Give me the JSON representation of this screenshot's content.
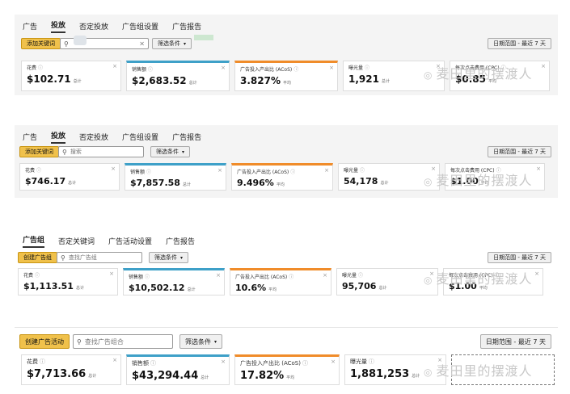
{
  "panel1": {
    "tabs": [
      "广告",
      "投放",
      "否定投放",
      "广告组设置",
      "广告报告"
    ],
    "active_tab": 1,
    "primary_button": "添加关键词",
    "search_placeholder": "",
    "filter_button": "筛选条件",
    "date_button": "日期范围 - 最近 7 天",
    "cards": [
      {
        "label": "花费",
        "value": "$102.71",
        "unit": "总计"
      },
      {
        "label": "销售额",
        "value": "$2,683.52",
        "unit": "总计"
      },
      {
        "label": "广告投入产出比 (ACoS)",
        "value": "3.827%",
        "unit": "平均"
      },
      {
        "label": "曝光量",
        "value": "1,921",
        "unit": "总计"
      },
      {
        "label": "每次点击费用 (CPC)",
        "value": "$0.85",
        "unit": "平均"
      }
    ]
  },
  "panel2": {
    "tabs": [
      "广告",
      "投放",
      "否定投放",
      "广告组设置",
      "广告报告"
    ],
    "active_tab": 1,
    "primary_button": "添加关键词",
    "search_placeholder": "搜索",
    "filter_button": "筛选条件",
    "date_button": "日期范围 - 最近 7 天",
    "cards": [
      {
        "label": "花费",
        "value": "$746.17",
        "unit": "总计"
      },
      {
        "label": "销售额",
        "value": "$7,857.58",
        "unit": "总计"
      },
      {
        "label": "广告投入产出比 (ACoS)",
        "value": "9.496%",
        "unit": "平均"
      },
      {
        "label": "曝光量",
        "value": "54,178",
        "unit": "总计"
      },
      {
        "label": "每次点击费用 (CPC)",
        "value": "$1.00",
        "unit": "平均"
      }
    ]
  },
  "panel3": {
    "tabs": [
      "广告组",
      "否定关键词",
      "广告活动设置",
      "广告报告"
    ],
    "active_tab": 0,
    "primary_button": "创建广告组",
    "search_placeholder": "查找广告组",
    "filter_button": "筛选条件",
    "date_button": "日期范围 - 最近 7 天",
    "cards": [
      {
        "label": "花费",
        "value": "$1,113.51",
        "unit": "总计"
      },
      {
        "label": "销售额",
        "value": "$10,502.12",
        "unit": "总计"
      },
      {
        "label": "广告投入产出比 (ACoS)",
        "value": "10.6%",
        "unit": "平均"
      },
      {
        "label": "曝光量",
        "value": "95,706",
        "unit": "总计"
      },
      {
        "label": "每次点击费用 (CPC)",
        "value": "$1.00",
        "unit": "平均"
      }
    ]
  },
  "panel4": {
    "primary_button": "创建广告活动",
    "search_placeholder": "查找广告组合",
    "filter_button": "筛选条件",
    "date_button": "日期范围 - 最近 7 天",
    "cards": [
      {
        "label": "花费",
        "value": "$7,713.66",
        "unit": "总计"
      },
      {
        "label": "销售额",
        "value": "$43,294.44",
        "unit": "总计"
      },
      {
        "label": "广告投入产出比 (ACoS)",
        "value": "17.82%",
        "unit": "平均"
      },
      {
        "label": "曝光量",
        "value": "1,881,253",
        "unit": "总计"
      }
    ]
  },
  "watermark": "麦田里的摆渡人",
  "colors": {
    "accent_button": "#f0c14b",
    "teal_bar": "#3ea0c8",
    "orange_bar": "#f08c2a"
  }
}
